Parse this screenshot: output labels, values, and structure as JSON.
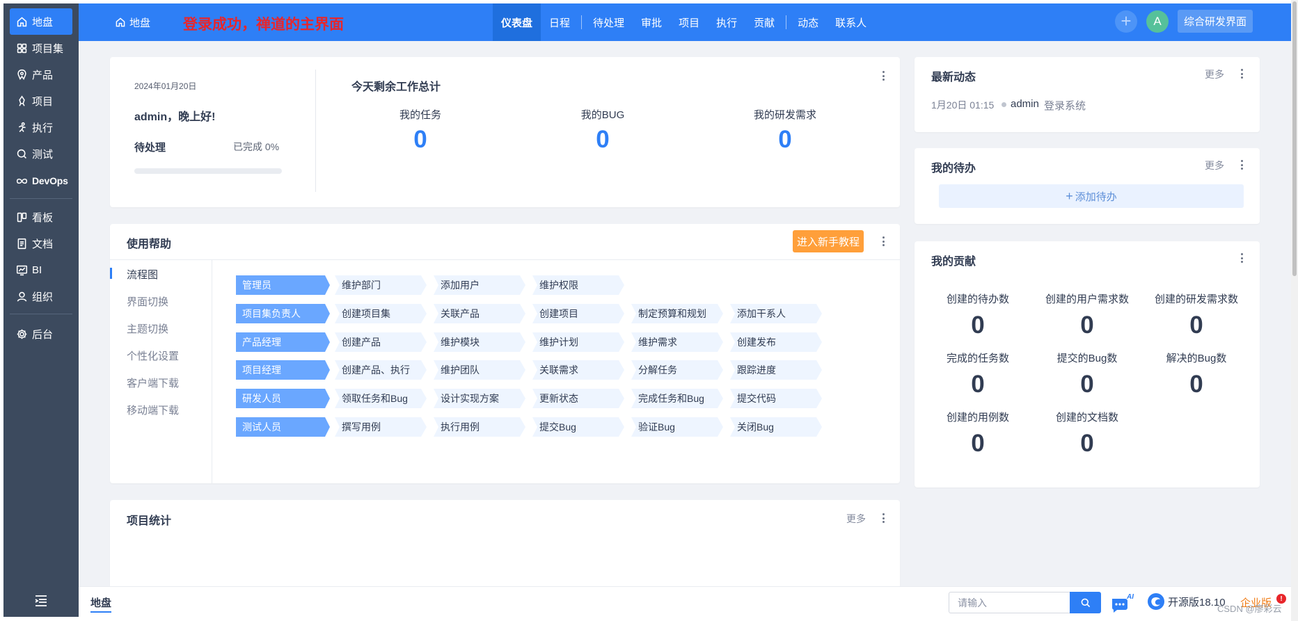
{
  "sidebar": {
    "items": [
      {
        "label": "地盘",
        "icon": "home-icon",
        "active": true
      },
      {
        "label": "项目集",
        "icon": "grid-icon"
      },
      {
        "label": "产品",
        "icon": "product-icon"
      },
      {
        "label": "项目",
        "icon": "project-icon"
      },
      {
        "label": "执行",
        "icon": "execution-icon"
      },
      {
        "label": "测试",
        "icon": "test-icon"
      },
      {
        "label": "DevOps",
        "icon": "infinity-icon"
      },
      {
        "label": "看板",
        "icon": "kanban-icon"
      },
      {
        "label": "文档",
        "icon": "doc-icon"
      },
      {
        "label": "BI",
        "icon": "chart-icon"
      },
      {
        "label": "组织",
        "icon": "user-icon"
      },
      {
        "label": "后台",
        "icon": "gear-icon"
      }
    ],
    "collapse_icon": "menu-collapse-icon"
  },
  "topbar": {
    "home_label": "地盘",
    "annotation": "登录成功，禅道的主界面",
    "nav": [
      "仪表盘",
      "日程",
      "待处理",
      "审批",
      "项目",
      "执行",
      "贡献",
      "动态",
      "联系人"
    ],
    "active_nav": "仪表盘",
    "avatar_letter": "A",
    "switch_label": "综合研发界面"
  },
  "welcome": {
    "date": "2024年01月20日",
    "greeting": "admin，晚上好!",
    "pending_label": "待处理",
    "done_label": "已完成 0%",
    "progress_percent": 0,
    "summary_title": "今天剩余工作总计",
    "stats": [
      {
        "label": "我的任务",
        "value": "0"
      },
      {
        "label": "我的BUG",
        "value": "0"
      },
      {
        "label": "我的研发需求",
        "value": "0"
      }
    ]
  },
  "help": {
    "title": "使用帮助",
    "tutorial_button": "进入新手教程",
    "tabs": [
      "流程图",
      "界面切换",
      "主题切换",
      "个性化设置",
      "客户端下载",
      "移动端下载"
    ],
    "active_tab": "流程图",
    "flows": [
      {
        "role": "管理员",
        "steps": [
          "维护部门",
          "添加用户",
          "维护权限"
        ]
      },
      {
        "role": "项目集负责人",
        "steps": [
          "创建项目集",
          "关联产品",
          "创建项目",
          "制定预算和规划",
          "添加干系人"
        ]
      },
      {
        "role": "产品经理",
        "steps": [
          "创建产品",
          "维护模块",
          "维护计划",
          "维护需求",
          "创建发布"
        ]
      },
      {
        "role": "项目经理",
        "steps": [
          "创建产品、执行",
          "维护团队",
          "关联需求",
          "分解任务",
          "跟踪进度"
        ]
      },
      {
        "role": "研发人员",
        "steps": [
          "领取任务和Bug",
          "设计实现方案",
          "更新状态",
          "完成任务和Bug",
          "提交代码"
        ]
      },
      {
        "role": "测试人员",
        "steps": [
          "撰写用例",
          "执行用例",
          "提交Bug",
          "验证Bug",
          "关闭Bug"
        ]
      }
    ]
  },
  "project_stats": {
    "title": "项目统计",
    "more": "更多"
  },
  "dynamics": {
    "title": "最新动态",
    "more": "更多",
    "items": [
      {
        "time": "1月20日 01:15",
        "user": "admin",
        "action": "登录系统"
      }
    ]
  },
  "todo": {
    "title": "我的待办",
    "more": "更多",
    "add_label": "添加待办"
  },
  "contribution": {
    "title": "我的贡献",
    "stats": [
      {
        "label": "创建的待办数",
        "value": "0"
      },
      {
        "label": "创建的用户需求数",
        "value": "0"
      },
      {
        "label": "创建的研发需求数",
        "value": "0"
      },
      {
        "label": "完成的任务数",
        "value": "0"
      },
      {
        "label": "提交的Bug数",
        "value": "0"
      },
      {
        "label": "解决的Bug数",
        "value": "0"
      },
      {
        "label": "创建的用例数",
        "value": "0"
      },
      {
        "label": "创建的文档数",
        "value": "0"
      }
    ]
  },
  "bottombar": {
    "home_tab": "地盘",
    "search_placeholder": "请输入",
    "ai_label": "AI",
    "version": "开源版18.10",
    "enterprise": "企业版",
    "badge": "!",
    "watermark": "CSDN @廖彩云"
  },
  "colors": {
    "primary": "#2e7ff6",
    "sidebar": "#3c4a5e",
    "annotation": "#e8262b",
    "tutorial": "#ff9f3a",
    "enterprise": "#f07a12"
  }
}
